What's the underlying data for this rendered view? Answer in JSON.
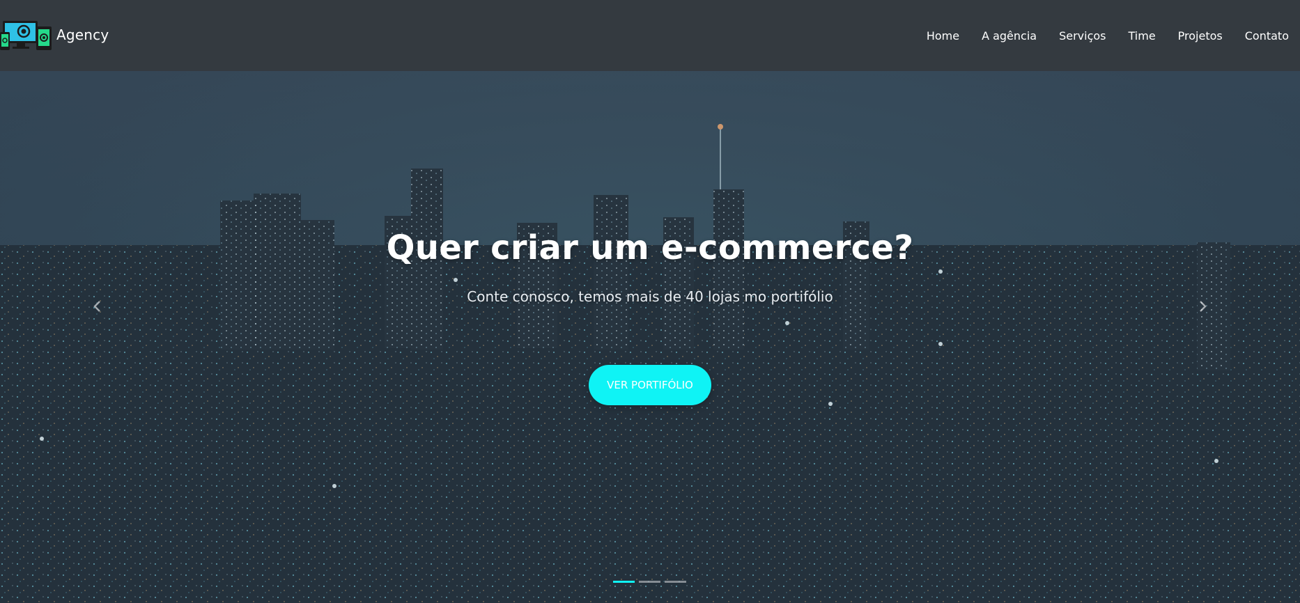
{
  "brand": {
    "name": "Agency",
    "logo_icon": "devices-logo-icon"
  },
  "nav": {
    "items": [
      {
        "label": "Home"
      },
      {
        "label": "A agência"
      },
      {
        "label": "Serviços"
      },
      {
        "label": "Time"
      },
      {
        "label": "Projetos"
      },
      {
        "label": "Contato"
      }
    ]
  },
  "hero": {
    "title": "Quer criar um e-commerce?",
    "subtitle": "Conte conosco, temos mais de 40 lojas mo portifólio",
    "button_label": "VER PORTIFÓLIO",
    "prev_icon": "chevron-left-icon",
    "next_icon": "chevron-right-icon",
    "slides_count": 3,
    "active_slide": 1
  },
  "colors": {
    "navbar_bg": "#343a40",
    "accent": "#0ff3f5",
    "text": "#ffffff"
  }
}
